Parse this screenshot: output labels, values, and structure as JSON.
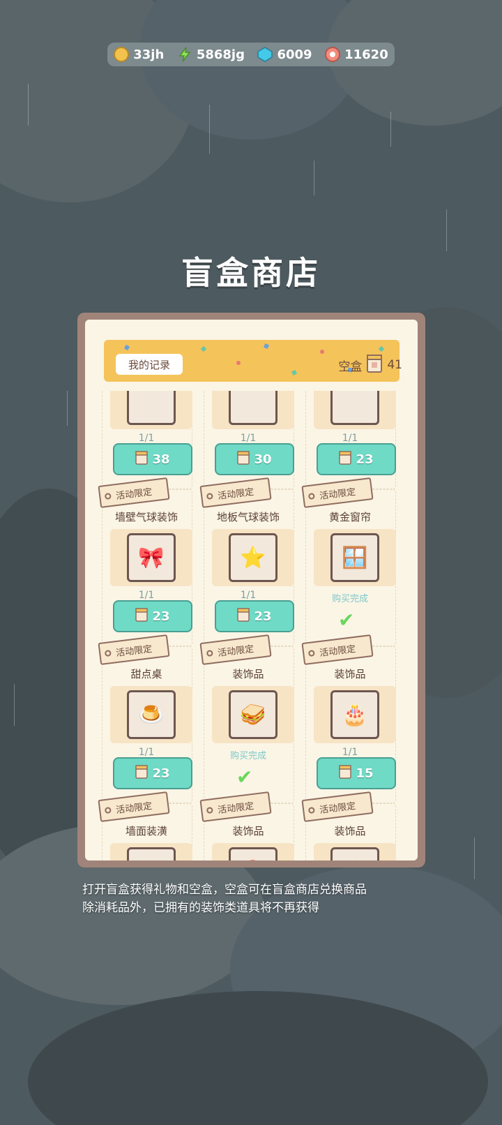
{
  "currency": [
    {
      "icon": "coin-icon",
      "value": "33jh",
      "color": "#f2c14e"
    },
    {
      "icon": "energy-icon",
      "value": "5868jg",
      "color": "#8ee25b"
    },
    {
      "icon": "gem-icon",
      "value": "6009",
      "color": "#44c9e8"
    },
    {
      "icon": "candy-icon",
      "value": "11620",
      "color": "#f28b7d"
    }
  ],
  "title": "盲盒商店",
  "banner": {
    "record_label": "我的记录",
    "box_label": "空盒",
    "box_count": "41"
  },
  "rows": [
    {
      "items": [
        {
          "tag": "",
          "name": "",
          "stock": "1/1",
          "price": "38",
          "state": "buy",
          "icon": "item-icon"
        },
        {
          "tag": "",
          "name": "",
          "stock": "1/1",
          "price": "30",
          "state": "buy",
          "icon": "item-icon"
        },
        {
          "tag": "",
          "name": "",
          "stock": "1/1",
          "price": "23",
          "state": "buy",
          "icon": "item-icon"
        }
      ]
    },
    {
      "items": [
        {
          "tag": "活动限定",
          "name": "墙壁气球装饰",
          "stock": "1/1",
          "price": "23",
          "state": "buy",
          "icon": "balloon-bow-icon"
        },
        {
          "tag": "活动限定",
          "name": "地板气球装饰",
          "stock": "1/1",
          "price": "23",
          "state": "buy",
          "icon": "balloon-star-icon"
        },
        {
          "tag": "活动限定",
          "name": "黄金窗帘",
          "stock": "",
          "price": "",
          "state": "done",
          "done_label": "购买完成",
          "icon": "curtain-icon"
        }
      ]
    },
    {
      "items": [
        {
          "tag": "活动限定",
          "name": "甜点桌",
          "stock": "1/1",
          "price": "23",
          "state": "buy",
          "icon": "dessert-table-icon"
        },
        {
          "tag": "活动限定",
          "name": "装饰品",
          "stock": "",
          "price": "",
          "state": "done",
          "done_label": "购买完成",
          "icon": "cake-box-icon"
        },
        {
          "tag": "活动限定",
          "name": "装饰品",
          "stock": "1/1",
          "price": "15",
          "state": "buy",
          "icon": "castle-cake-icon"
        }
      ]
    },
    {
      "items": [
        {
          "tag": "活动限定",
          "name": "墙面装潢",
          "stock": "",
          "price": "",
          "state": "buy",
          "icon": "bell-bunting-icon"
        },
        {
          "tag": "活动限定",
          "name": "装饰品",
          "stock": "",
          "price": "",
          "state": "buy",
          "icon": "balloon-card-icon"
        },
        {
          "tag": "活动限定",
          "name": "装饰品",
          "stock": "",
          "price": "",
          "state": "buy",
          "icon": "flower-icon"
        }
      ]
    }
  ],
  "description": [
    "打开盲盒获得礼物和空盒，空盒可在盲盒商店兑换商品",
    "除消耗品外，已拥有的装饰类道具将不再获得"
  ]
}
